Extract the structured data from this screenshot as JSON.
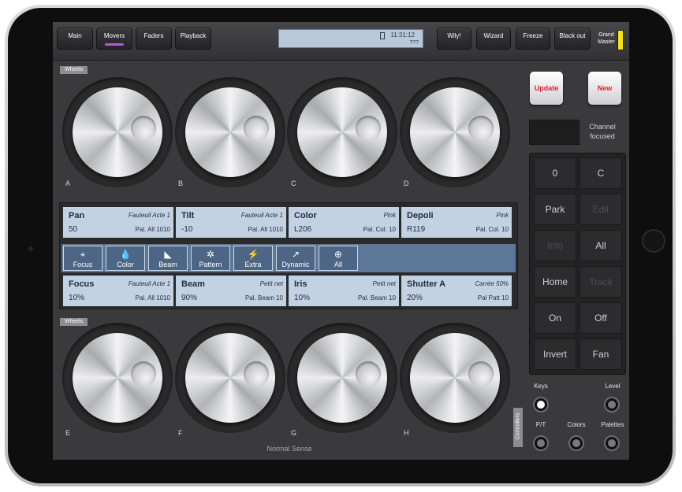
{
  "topbar": {
    "buttons": [
      {
        "label": "Main",
        "active": false
      },
      {
        "label": "Movers",
        "active": true
      },
      {
        "label": "Faders",
        "active": false
      },
      {
        "label": "Playback",
        "active": false
      }
    ],
    "right_buttons": [
      {
        "label": "Wily!"
      },
      {
        "label": "Wizard"
      },
      {
        "label": "Freeze"
      },
      {
        "label": "Black out"
      }
    ],
    "clock": "11:31:12",
    "battery": "???",
    "grand_master": "Grand Master",
    "accent_color": "#b15bd6",
    "grand_master_color": "#f2e40f"
  },
  "wheels_top": {
    "tag": "Wheels",
    "labels": [
      "A",
      "B",
      "C",
      "D"
    ]
  },
  "wheels_bottom": {
    "tag": "Wheels",
    "labels": [
      "E",
      "F",
      "G",
      "H"
    ]
  },
  "info_top": [
    {
      "name": "Pan",
      "preset": "Fauteuil Acte 1",
      "value": "50",
      "palette": "Pal. All 1010"
    },
    {
      "name": "Tilt",
      "preset": "Fauteuil Acte 1",
      "value": "-10",
      "palette": "Pal. All 1010"
    },
    {
      "name": "Color",
      "preset": "Pink",
      "value": "L206",
      "palette": "Pal. Col. 10"
    },
    {
      "name": "Depoli",
      "preset": "Pink",
      "value": "R119",
      "palette": "Pal. Col. 10"
    }
  ],
  "attributes": [
    {
      "label": "Focus",
      "icon": "crosshair-icon"
    },
    {
      "label": "Color",
      "icon": "droplet-icon"
    },
    {
      "label": "Beam",
      "icon": "beam-icon"
    },
    {
      "label": "Pattern",
      "icon": "gobo-icon"
    },
    {
      "label": "Extra",
      "icon": "lightning-icon"
    },
    {
      "label": "Dynamic",
      "icon": "dynamic-icon"
    },
    {
      "label": "All",
      "icon": "globe-icon"
    }
  ],
  "info_bottom": [
    {
      "name": "Focus",
      "preset": "Fauteuil Acte 1",
      "value": "10%",
      "palette": "Pal. All 1010"
    },
    {
      "name": "Beam",
      "preset": "Petit net",
      "value": "90%",
      "palette": "Pal. Beam 10"
    },
    {
      "name": "Iris",
      "preset": "Petit net",
      "value": "10%",
      "palette": "Pal. Beam 10"
    },
    {
      "name": "Shutter A",
      "preset": "Carrée 50%",
      "value": "20%",
      "palette": "Pal Patt 10"
    }
  ],
  "side": {
    "update": "Update",
    "new": "New",
    "channel_focused": "Channel focused"
  },
  "keypad": [
    {
      "label": "0",
      "enabled": true
    },
    {
      "label": "C",
      "enabled": true
    },
    {
      "label": "Park",
      "enabled": true
    },
    {
      "label": "Edit",
      "enabled": false
    },
    {
      "label": "Info",
      "enabled": false
    },
    {
      "label": "All",
      "enabled": true
    },
    {
      "label": "Home",
      "enabled": true
    },
    {
      "label": "Track",
      "enabled": false
    },
    {
      "label": "On",
      "enabled": true
    },
    {
      "label": "Off",
      "enabled": true
    },
    {
      "label": "Invert",
      "enabled": true
    },
    {
      "label": "Fan",
      "enabled": true
    }
  ],
  "modes": {
    "keys": "Keys",
    "level": "Level",
    "pt": "P/T",
    "colors": "Colors",
    "palettes": "Palettes",
    "controllers": "Controllers"
  },
  "footer": "Normal Sense"
}
